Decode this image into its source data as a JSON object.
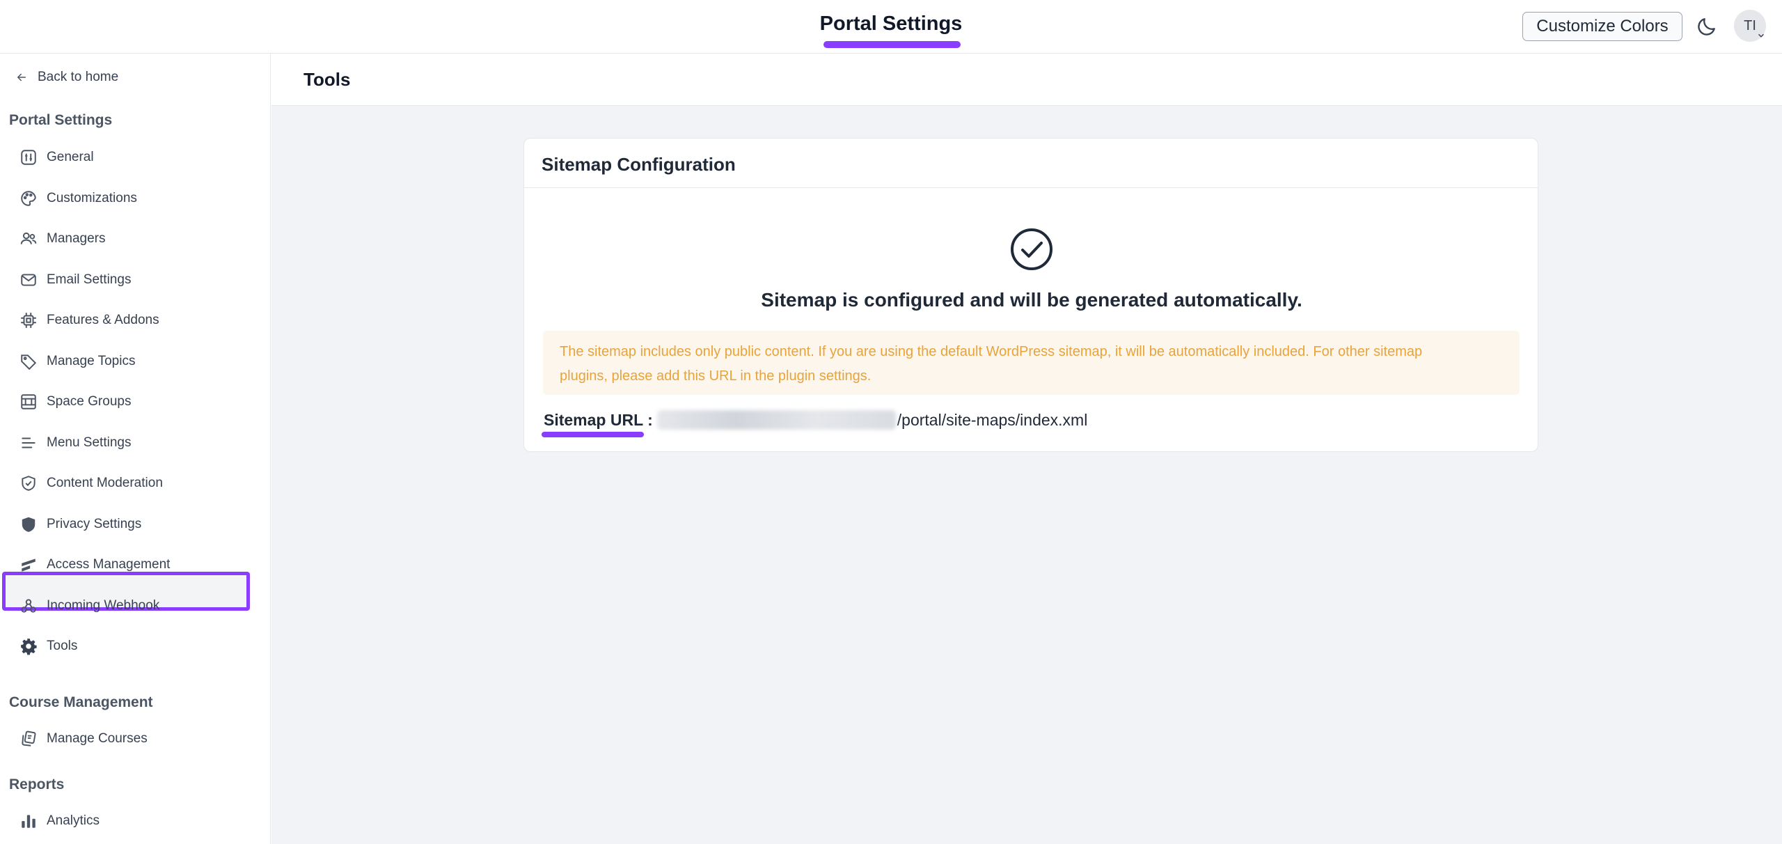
{
  "header": {
    "title": "Portal Settings",
    "customize_button": "Customize Colors",
    "avatar_initials": "TI",
    "accent_color": "#8b3dff"
  },
  "sidebar": {
    "back_label": "Back to home",
    "sections": [
      {
        "title": "Portal Settings",
        "items": [
          {
            "label": "General",
            "icon": "sliders-icon"
          },
          {
            "label": "Customizations",
            "icon": "palette-icon"
          },
          {
            "label": "Managers",
            "icon": "users-icon"
          },
          {
            "label": "Email Settings",
            "icon": "mail-icon"
          },
          {
            "label": "Features & Addons",
            "icon": "chip-icon"
          },
          {
            "label": "Manage Topics",
            "icon": "tag-icon"
          },
          {
            "label": "Space Groups",
            "icon": "grid-icon"
          },
          {
            "label": "Menu Settings",
            "icon": "menu-icon"
          },
          {
            "label": "Content Moderation",
            "icon": "shield-check-icon"
          },
          {
            "label": "Privacy Settings",
            "icon": "shield-icon"
          },
          {
            "label": "Access Management",
            "icon": "access-icon"
          },
          {
            "label": "Incoming Webhook",
            "icon": "webhook-icon"
          },
          {
            "label": "Tools",
            "icon": "gear-icon",
            "active": true
          }
        ]
      },
      {
        "title": "Course Management",
        "items": [
          {
            "label": "Manage Courses",
            "icon": "courses-icon"
          }
        ]
      },
      {
        "title": "Reports",
        "items": [
          {
            "label": "Analytics",
            "icon": "bar-chart-icon"
          }
        ]
      }
    ]
  },
  "main": {
    "page_title": "Tools",
    "card": {
      "title": "Sitemap Configuration",
      "status": "Sitemap is configured and will be generated automatically.",
      "notice_line1": "The sitemap includes only public content. If you are using the default WordPress sitemap, it will be automatically included. For other sitemap",
      "notice_line2": "plugins, please add this URL in the plugin settings.",
      "url_label": "Sitemap URL :",
      "url_path": "/portal/site-maps/index.xml"
    }
  }
}
